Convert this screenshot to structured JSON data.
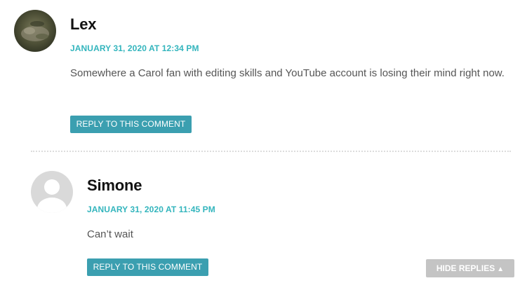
{
  "comments": [
    {
      "author": "Lex",
      "date": "JANUARY 31, 2020 AT 12:34 PM",
      "text": "Somewhere a Carol fan with editing skills and YouTube account is losing their mind right now.",
      "reply_label": "REPLY TO THIS COMMENT"
    },
    {
      "author": "Simone",
      "date": "JANUARY 31, 2020 AT 11:45 PM",
      "text": "Can’t wait",
      "reply_label": "REPLY TO THIS COMMENT"
    }
  ],
  "hide_replies": {
    "label": "HIDE REPLIES",
    "icon": "triangle-up-icon",
    "arrow": "▲"
  },
  "colors": {
    "accent": "#33b5bd",
    "button": "#3b9fb0",
    "hide_button": "#c4c4c4",
    "text": "#555555"
  }
}
